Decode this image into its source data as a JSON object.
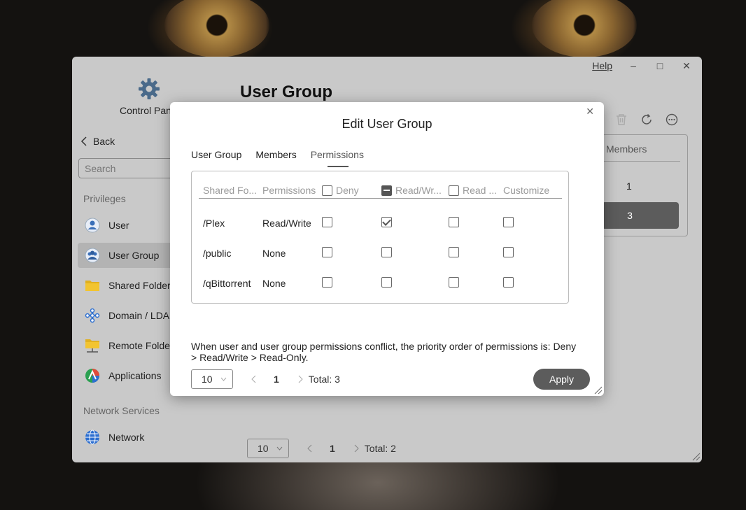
{
  "window": {
    "help_label": "Help",
    "minimize_glyph": "–",
    "maximize_glyph": "□",
    "close_glyph": "✕"
  },
  "sidebar": {
    "app_title": "Control Panel",
    "back_label": "Back",
    "search_placeholder": "Search",
    "sections": {
      "privileges": "Privileges",
      "network_services": "Network Services"
    },
    "items": [
      {
        "label": "User",
        "icon": "user-icon"
      },
      {
        "label": "User Group",
        "icon": "user-group-icon"
      },
      {
        "label": "Shared Folders",
        "icon": "folder-icon"
      },
      {
        "label": "Domain / LDAP",
        "icon": "domain-icon"
      },
      {
        "label": "Remote Folders",
        "icon": "remote-folder-icon"
      },
      {
        "label": "Applications",
        "icon": "applications-icon"
      },
      {
        "label": "Network",
        "icon": "network-icon"
      }
    ]
  },
  "main": {
    "title": "User Group",
    "table": {
      "members_header": "Members",
      "rows": [
        {
          "members": "1"
        },
        {
          "members": "3"
        }
      ]
    },
    "pager": {
      "page_size": "10",
      "page": "1",
      "total": "Total: 2"
    }
  },
  "dialog": {
    "title": "Edit User Group",
    "close_glyph": "✕",
    "tabs": [
      "User Group",
      "Members",
      "Permissions"
    ],
    "active_tab": "Permissions",
    "headers": {
      "shared_folder": "Shared Fo...",
      "permissions": "Permissions",
      "deny": "Deny",
      "read_write": "Read/Wr...",
      "read_only": "Read ...",
      "customize": "Customize"
    },
    "rows": [
      {
        "folder": "/Plex",
        "permission": "Read/Write",
        "deny": false,
        "read_write": true,
        "read_only": false,
        "customize": false
      },
      {
        "folder": "/public",
        "permission": "None",
        "deny": false,
        "read_write": false,
        "read_only": false,
        "customize": false
      },
      {
        "folder": "/qBittorrent",
        "permission": "None",
        "deny": false,
        "read_write": false,
        "read_only": false,
        "customize": false
      }
    ],
    "note": "When user and user group permissions conflict, the priority order of permissions is: Deny > Read/Write > Read-Only.",
    "pager": {
      "page_size": "10",
      "page": "1",
      "total": "Total: 3"
    },
    "apply_label": "Apply"
  },
  "colors": {
    "window_bg": "#c9c9c9",
    "active_item_bg": "#b3b3b3",
    "button_dark": "#5c5c5c",
    "dialog_bg": "#ffffff"
  }
}
